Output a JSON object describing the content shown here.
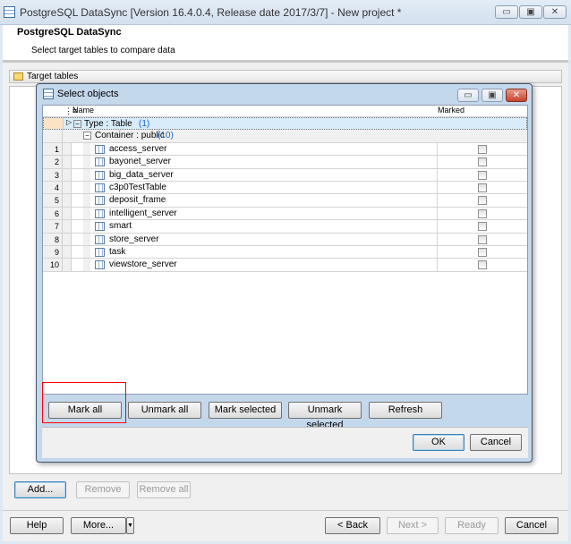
{
  "window": {
    "title": "PostgreSQL DataSync [Version 16.4.0.4, Release date 2017/3/7] - New project *",
    "minimize": "▭",
    "maximize": "▣",
    "close": "✕"
  },
  "header": {
    "title": "PostgreSQL DataSync",
    "subtitle": "Select target tables to compare data"
  },
  "panel": {
    "title": "Target tables"
  },
  "dialog": {
    "title": "Select objects",
    "columns": {
      "name": "Name",
      "marked": "Marked"
    },
    "group": {
      "label": "Type : Table",
      "count": "(1)"
    },
    "container": {
      "label": "Container : public",
      "count": "(10)"
    },
    "rows": [
      {
        "n": "1",
        "name": "access_server",
        "marked": false
      },
      {
        "n": "2",
        "name": "bayonet_server",
        "marked": false
      },
      {
        "n": "3",
        "name": "big_data_server",
        "marked": false
      },
      {
        "n": "4",
        "name": "c3p0TestTable",
        "marked": false
      },
      {
        "n": "5",
        "name": "deposit_frame",
        "marked": false
      },
      {
        "n": "6",
        "name": "intelligent_server",
        "marked": false
      },
      {
        "n": "7",
        "name": "smart",
        "marked": false
      },
      {
        "n": "8",
        "name": "store_server",
        "marked": false
      },
      {
        "n": "9",
        "name": "task",
        "marked": false
      },
      {
        "n": "10",
        "name": "viewstore_server",
        "marked": false
      }
    ],
    "buttons": {
      "mark_all": "Mark all",
      "unmark_all": "Unmark all",
      "mark_selected": "Mark selected",
      "unmark_selected": "Unmark selected",
      "refresh": "Refresh",
      "ok": "OK",
      "cancel": "Cancel"
    }
  },
  "list_buttons": {
    "add": "Add...",
    "remove": "Remove",
    "remove_all": "Remove all"
  },
  "footer": {
    "help": "Help",
    "more": "More...",
    "back": "< Back",
    "next": "Next >",
    "ready": "Ready",
    "cancel": "Cancel"
  },
  "colors": {
    "highlight": "#ff0000",
    "link_count": "#1a66cc"
  }
}
